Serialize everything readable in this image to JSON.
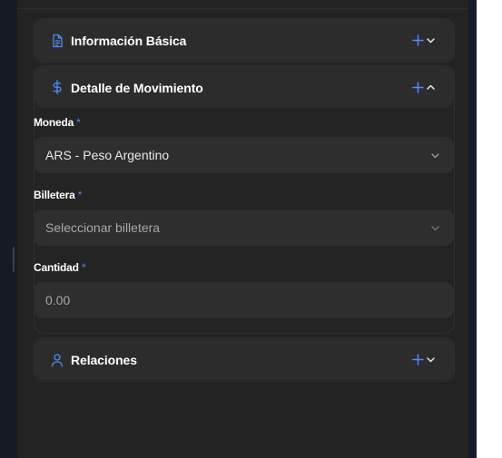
{
  "sections": {
    "basic": {
      "title": "Información Básica",
      "icon": "document-icon"
    },
    "movement": {
      "title": "Detalle de Movimiento",
      "icon": "dollar-icon"
    },
    "relations": {
      "title": "Relaciones",
      "icon": "user-icon"
    }
  },
  "fields": {
    "currency": {
      "label": "Moneda",
      "required_mark": "*",
      "value": "ARS - Peso Argentino"
    },
    "wallet": {
      "label": "Billetera",
      "required_mark": "*",
      "placeholder": "Seleccionar billetera"
    },
    "amount": {
      "label": "Cantidad",
      "required_mark": "*",
      "placeholder": "0.00"
    }
  },
  "colors": {
    "accent": "#4f8bf2",
    "panel": "#232323",
    "header": "#2c2c2c",
    "input": "#2e2e2e"
  }
}
